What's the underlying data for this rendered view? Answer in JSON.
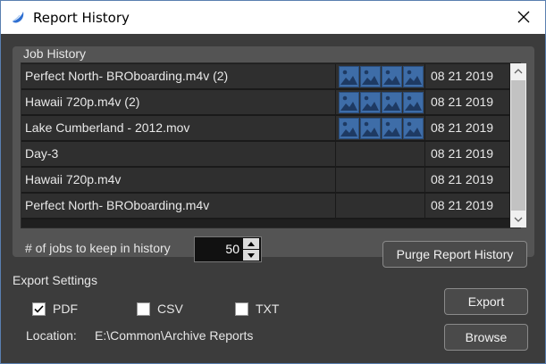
{
  "window": {
    "title": "Report History",
    "accent_color": "#3e6da8"
  },
  "job_history": {
    "group_title": "Job History",
    "rows": [
      {
        "name": "Perfect North- BROboarding.m4v (2)",
        "thumbnails": 4,
        "date": "08 21 2019"
      },
      {
        "name": "Hawaii 720p.m4v (2)",
        "thumbnails": 4,
        "date": "08 21 2019"
      },
      {
        "name": "Lake Cumberland - 2012.mov",
        "thumbnails": 4,
        "date": "08 21 2019"
      },
      {
        "name": "Day-3",
        "thumbnails": 0,
        "date": "08 21 2019"
      },
      {
        "name": "Hawaii 720p.m4v",
        "thumbnails": 0,
        "date": "08 21 2019"
      },
      {
        "name": "Perfect North- BROboarding.m4v",
        "thumbnails": 0,
        "date": "08 21 2019"
      }
    ],
    "keep_label": "# of jobs to keep in history",
    "keep_value": "50",
    "purge_label": "Purge Report History"
  },
  "export": {
    "section_label": "Export Settings",
    "options": [
      {
        "label": "PDF",
        "checked": true
      },
      {
        "label": "CSV",
        "checked": false
      },
      {
        "label": "TXT",
        "checked": false
      }
    ],
    "location_label": "Location:",
    "location_value": "E:\\Common\\Archive Reports",
    "export_label": "Export",
    "browse_label": "Browse"
  }
}
